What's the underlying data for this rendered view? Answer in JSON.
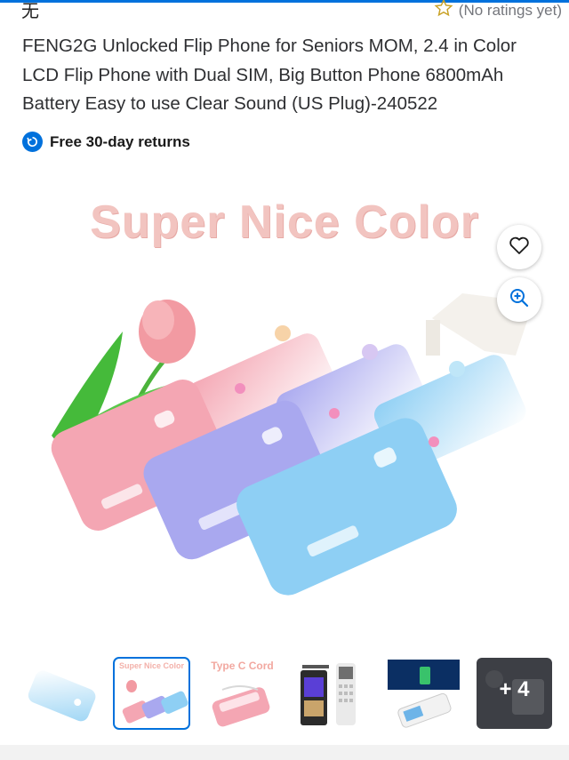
{
  "header": {
    "seller_glyph": "无",
    "rating_text": "(No ratings yet)"
  },
  "product": {
    "title": "FENG2G Unlocked Flip Phone for Seniors MOM, 2.4 in Color LCD Flip Phone with Dual SIM, Big Button Phone 6800mAh Battery Easy to use Clear Sound (US Plug)-240522",
    "returns_text": "Free 30-day returns"
  },
  "gallery": {
    "banner_text": "Super Nice Color",
    "thumbnails": [
      {
        "caption": ""
      },
      {
        "caption": "Super Nice Color",
        "selected": true
      },
      {
        "caption": "Type C Cord"
      },
      {
        "caption": ""
      },
      {
        "caption": ""
      },
      {
        "caption": "+ 4"
      }
    ]
  },
  "colors": {
    "accent": "#0071dc",
    "pink_phone": "#f4a9b4",
    "purple_phone": "#a9a9ef",
    "blue_phone": "#8fd0f4"
  }
}
